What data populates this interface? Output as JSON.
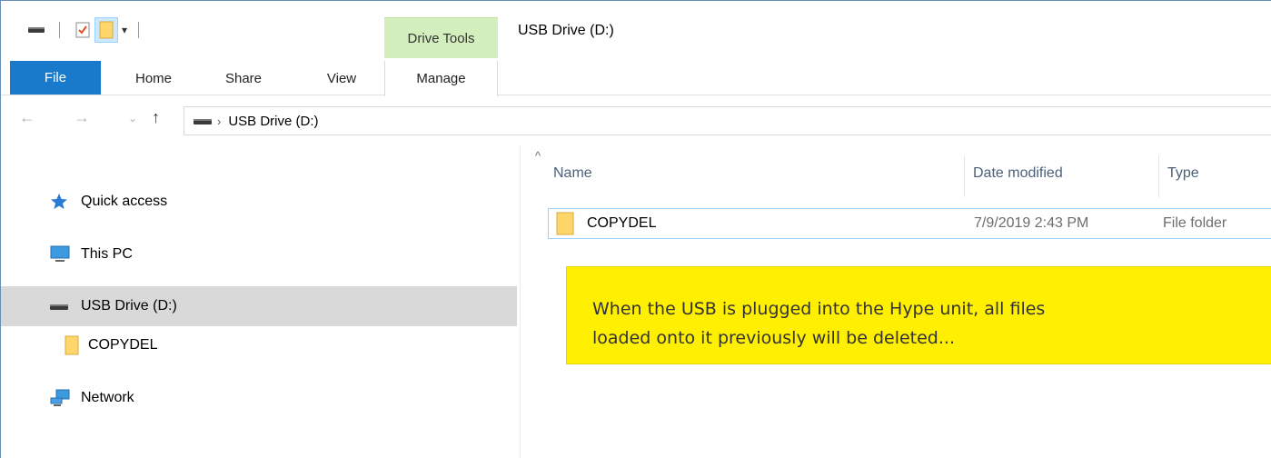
{
  "window": {
    "title": "USB Drive (D:)",
    "context_tab_group": "Drive Tools"
  },
  "ribbon": {
    "tabs": [
      {
        "label": "File"
      },
      {
        "label": "Home"
      },
      {
        "label": "Share"
      },
      {
        "label": "View"
      },
      {
        "label": "Manage"
      }
    ]
  },
  "address_bar": {
    "crumbs": [
      "USB Drive (D:)"
    ]
  },
  "nav_pane": {
    "items": [
      {
        "label": "Quick access",
        "icon": "star-icon"
      },
      {
        "label": "This PC",
        "icon": "computer-icon"
      },
      {
        "label": "USB Drive (D:)",
        "icon": "usb-drive-icon",
        "selected": true
      },
      {
        "label": "COPYDEL",
        "icon": "folder-icon"
      },
      {
        "label": "Network",
        "icon": "network-icon"
      }
    ]
  },
  "file_list": {
    "columns": [
      "Name",
      "Date modified",
      "Type"
    ],
    "rows": [
      {
        "name": "COPYDEL",
        "date": "7/9/2019 2:43 PM",
        "type": "File folder"
      }
    ]
  },
  "callout": {
    "line1": "When the USB is plugged into the Hype unit, all files",
    "line2": "loaded onto it previously will be deleted..."
  },
  "colors": {
    "file_tab": "#1979ca",
    "drive_tools": "#d2efbd",
    "selection": "#d9d9d9",
    "callout": "#ffef00"
  }
}
